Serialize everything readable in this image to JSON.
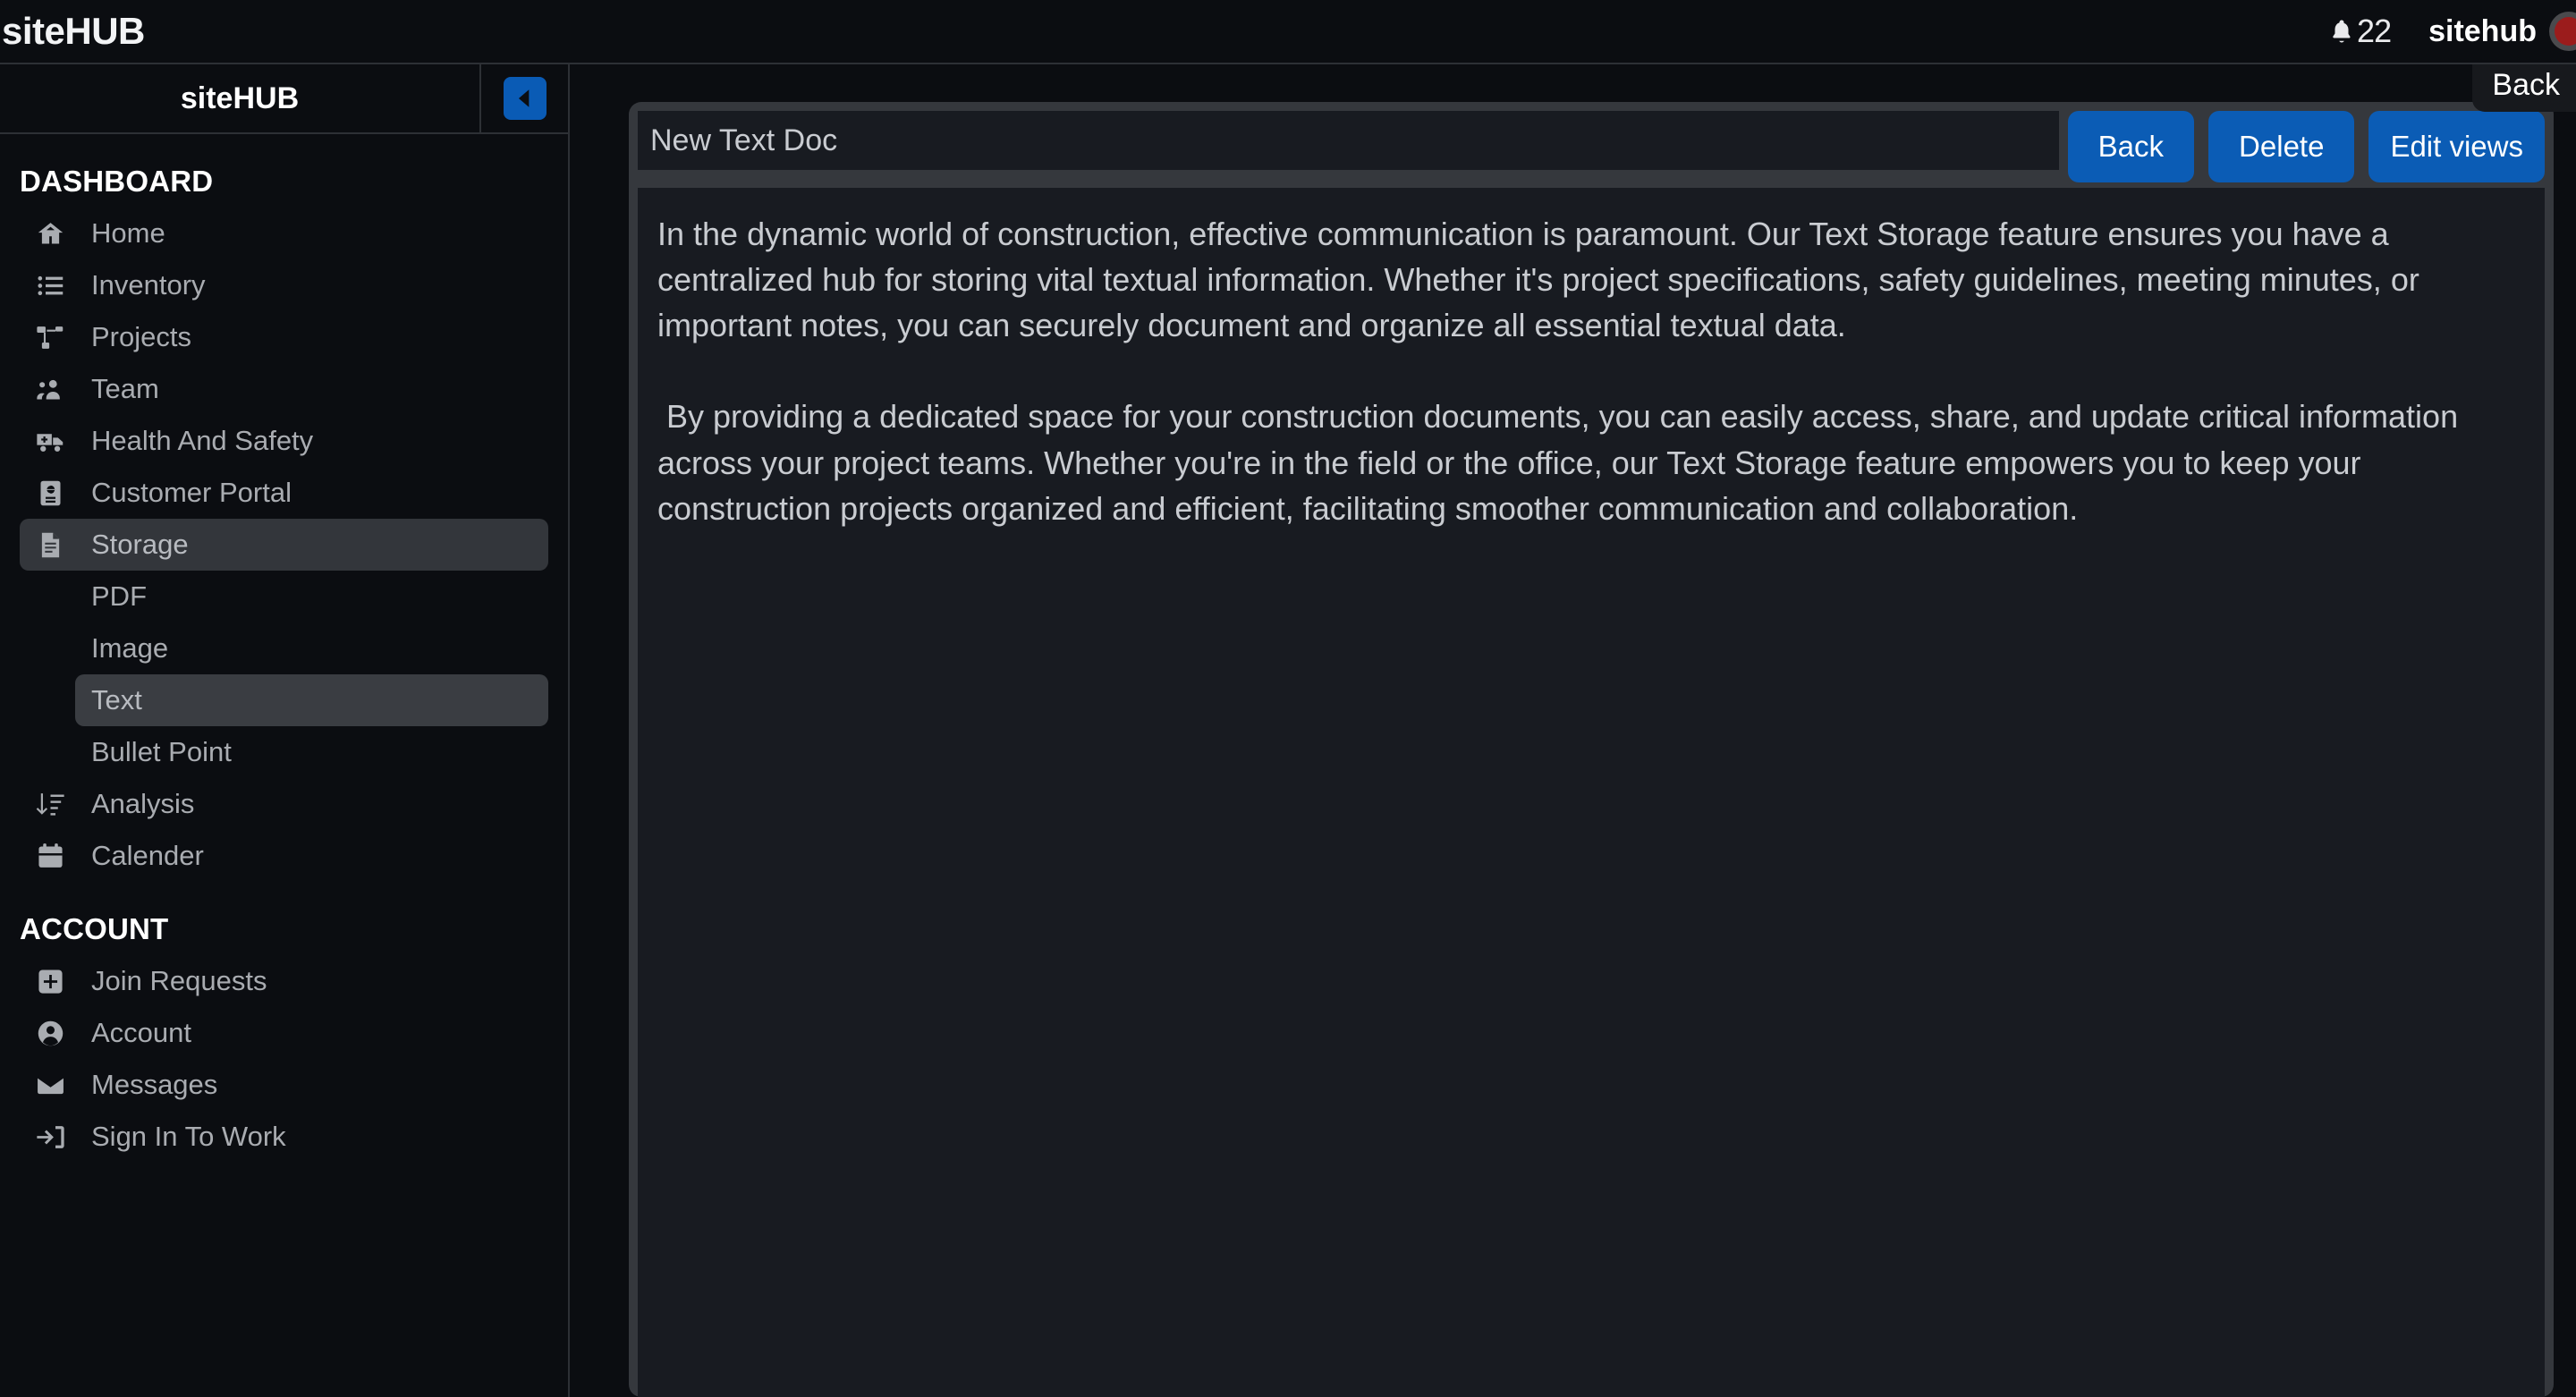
{
  "topbar": {
    "brand": "siteHUB",
    "notification_icon": "bell-icon",
    "notification_count": "22",
    "username": "sitehub",
    "avatar_color": "#9b1c1c"
  },
  "sidebar": {
    "title": "siteHUB",
    "collapse_icon": "chevron-left-icon",
    "accent": "#0a5bb5",
    "sections": [
      {
        "heading": "DASHBOARD",
        "items": [
          {
            "label": "Home",
            "icon": "home-icon",
            "active": false
          },
          {
            "label": "Inventory",
            "icon": "list-icon",
            "active": false
          },
          {
            "label": "Projects",
            "icon": "sitemap-icon",
            "active": false
          },
          {
            "label": "Team",
            "icon": "users-icon",
            "active": false
          },
          {
            "label": "Health And Safety",
            "icon": "ambulance-icon",
            "active": false
          },
          {
            "label": "Customer Portal",
            "icon": "id-card-icon",
            "active": false
          },
          {
            "label": "Storage",
            "icon": "file-lines-icon",
            "active": true
          }
        ],
        "sub_items": [
          {
            "label": "PDF",
            "active": false
          },
          {
            "label": "Image",
            "active": false
          },
          {
            "label": "Text",
            "active": true
          },
          {
            "label": "Bullet Point",
            "active": false
          }
        ],
        "items_after": [
          {
            "label": "Analysis",
            "icon": "sort-amount-down-icon",
            "active": false
          },
          {
            "label": "Calender",
            "icon": "calendar-icon",
            "active": false
          }
        ]
      },
      {
        "heading": "ACCOUNT",
        "items": [
          {
            "label": "Join Requests",
            "icon": "plus-square-icon",
            "active": false
          },
          {
            "label": "Account",
            "icon": "user-circle-icon",
            "active": false
          },
          {
            "label": "Messages",
            "icon": "envelope-icon",
            "active": false
          },
          {
            "label": "Sign In To Work",
            "icon": "sign-in-icon",
            "active": false
          }
        ]
      }
    ]
  },
  "main": {
    "back_tooltip": "Back",
    "document": {
      "title_value": "New Text Doc",
      "title_placeholder": "New Text Doc",
      "body": "In the dynamic world of construction, effective communication is paramount. Our Text Storage feature ensures you have a centralized hub for storing vital textual information. Whether it's project specifications, safety guidelines, meeting minutes, or important notes, you can securely document and organize all essential textual data.\n\n By providing a dedicated space for your construction documents, you can easily access, share, and update critical information across your project teams. Whether you're in the field or the office, our Text Storage feature empowers you to keep your construction projects organized and efficient, facilitating smoother communication and collaboration."
    },
    "actions": [
      {
        "label": "Back",
        "name": "back-button"
      },
      {
        "label": "Delete",
        "name": "delete-button"
      },
      {
        "label": "Edit views",
        "name": "edit-views-button"
      }
    ]
  }
}
